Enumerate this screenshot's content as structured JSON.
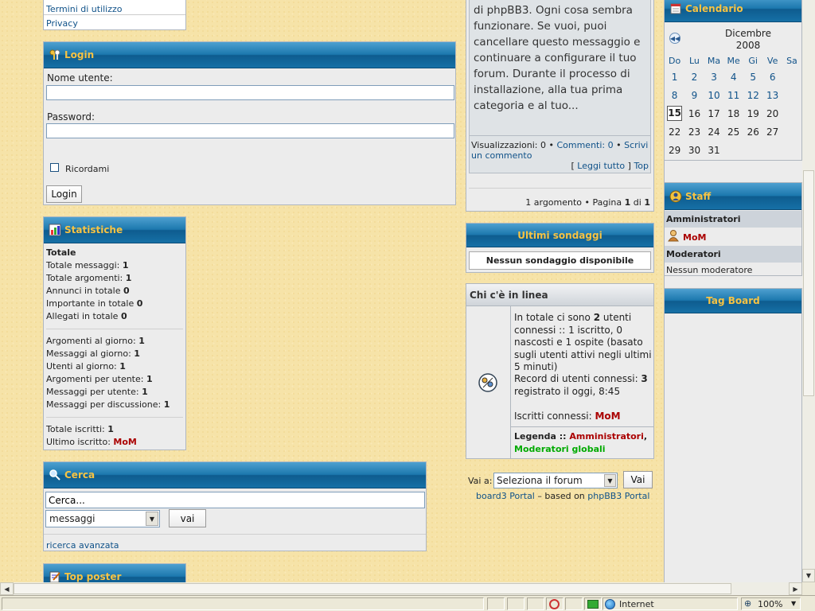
{
  "colors": {
    "header_text": "#f7c343",
    "header_blue": "#1670a6",
    "link": "#105289",
    "admin_red": "#aa0000",
    "mod_green": "#00aa00"
  },
  "menu_top": {
    "items": [
      "Termini di utilizzo",
      "Privacy"
    ]
  },
  "login": {
    "title": "Login",
    "icon": "keys-icon",
    "username_label": "Nome utente:",
    "username_value": "",
    "password_label": "Password:",
    "password_value": "",
    "remember_label": "Ricordami",
    "remember_checked": false,
    "button": "Login"
  },
  "stats": {
    "title": "Statistiche",
    "icon": "stats-icon",
    "total_heading": "Totale",
    "lines": [
      {
        "label": "Totale messaggi:",
        "value": "1"
      },
      {
        "label": "Totale argomenti:",
        "value": "1"
      },
      {
        "label": "Annunci in totale",
        "value": "0"
      },
      {
        "label": "Importante in totale",
        "value": "0"
      },
      {
        "label": "Allegati in totale",
        "value": "0"
      }
    ],
    "daily": [
      {
        "label": "Argomenti al giorno:",
        "value": "1"
      },
      {
        "label": "Messaggi al giorno:",
        "value": "1"
      },
      {
        "label": "Utenti al giorno:",
        "value": "1"
      },
      {
        "label": "Argomenti per utente:",
        "value": "1"
      },
      {
        "label": "Messaggi per utente:",
        "value": "1"
      },
      {
        "label": "Messaggi per discussione:",
        "value": "1"
      }
    ],
    "registered_label": "Totale iscritti:",
    "registered_value": "1",
    "last_label": "Ultimo iscritto:",
    "last_user": "MoM"
  },
  "search": {
    "title": "Cerca",
    "icon": "magnifier-icon",
    "input_value": "Cerca...",
    "select_value": "messaggi",
    "button": "vai",
    "advanced": "ricerca avanzata"
  },
  "top_poster": {
    "title": "Top poster",
    "icon": "notepad-icon"
  },
  "news": {
    "text": "di phpBB3. Ogni cosa sembra funzionare. Se vuoi, puoi cancellare questo messaggio e continuare a configurare il tuo forum. Durante il processo di installazione, alla tua prima categoria e al tuo...",
    "views_label": "Visualizzazioni: 0",
    "comments_label": "Commenti: 0",
    "write_comment": "Scrivi un commento",
    "read_all": "Leggi tutto",
    "top": "Top",
    "pagination_prefix": "1 argomento • Pagina ",
    "page_current": "1",
    "page_of": " di ",
    "page_total": "1"
  },
  "polls": {
    "title": "Ultimi sondaggi",
    "empty": "Nessun sondaggio disponibile"
  },
  "online": {
    "title": "Chi c'è in linea",
    "icon": "online-users-icon",
    "summary_a": "In totale ci sono ",
    "summary_count": "2",
    "summary_b": " utenti connessi :: 1 iscritto, 0 nascosti e 1 ospite (basato sugli utenti attivi negli ultimi 5 minuti)",
    "record_a": "Record di utenti connessi: ",
    "record_count": "3",
    "record_b": " registrato il oggi, 8:45",
    "members_label": "Iscritti connessi:",
    "members_user": "MoM",
    "legend_label": "Legenda ::",
    "legend_admins": "Amministratori",
    "legend_mods": "Moderatori globali"
  },
  "jump": {
    "label": "Vai a:",
    "select_value": "Seleziona il forum",
    "button": "Vai"
  },
  "footer": {
    "portal_link": "board3 Portal",
    "based_on": " – based on ",
    "phpbb_link": "phpBB3 Portal"
  },
  "calendar": {
    "title": "Calendario",
    "icon": "calendar-icon",
    "month": "Dicembre",
    "year": "2008",
    "weekdays": [
      "Do",
      "Lu",
      "Ma",
      "Me",
      "Gi",
      "Ve",
      "Sa"
    ],
    "weeks": [
      [
        "1",
        "2",
        "3",
        "4",
        "5",
        "6",
        ""
      ],
      [
        "8",
        "9",
        "10",
        "11",
        "12",
        "13",
        ""
      ],
      [
        "15",
        "16",
        "17",
        "18",
        "19",
        "20",
        ""
      ],
      [
        "22",
        "23",
        "24",
        "25",
        "26",
        "27",
        ""
      ],
      [
        "29",
        "30",
        "31",
        "",
        "",
        "",
        ""
      ]
    ],
    "today": "15"
  },
  "staff": {
    "title": "Staff",
    "icon": "staff-icon",
    "admins_heading": "Amministratori",
    "admin_user": "MoM",
    "mods_heading": "Moderatori",
    "mods_empty": "Nessun moderatore"
  },
  "tagboard": {
    "title": "Tag Board"
  },
  "statusbar": {
    "zone": "Internet",
    "zoom": "100%"
  }
}
